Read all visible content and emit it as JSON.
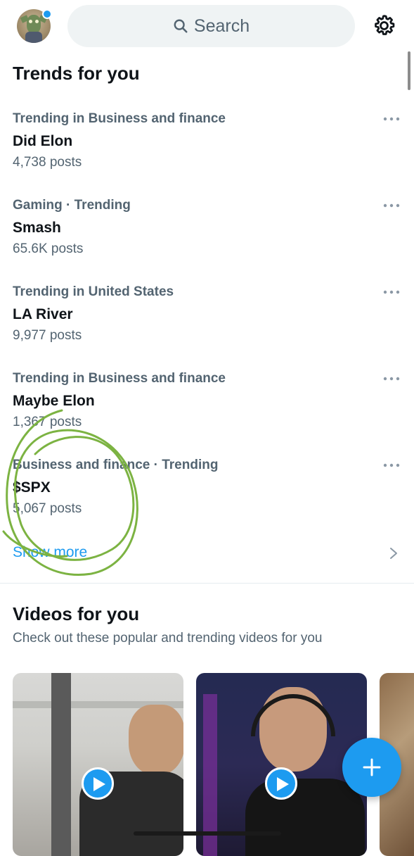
{
  "header": {
    "search_placeholder": "Search",
    "icons": {
      "search": "search-icon",
      "settings": "gear-icon"
    },
    "notification_dot_color": "#1d9bf0"
  },
  "trends_section": {
    "title": "Trends for you",
    "items": [
      {
        "context": "Trending in Business and finance",
        "name": "Did Elon",
        "posts": "4,738 posts"
      },
      {
        "context": "Gaming · Trending",
        "name": "Smash",
        "posts": "65.6K posts"
      },
      {
        "context": "Trending in United States",
        "name": "LA River",
        "posts": "9,977 posts"
      },
      {
        "context": "Trending in Business and finance",
        "name": "Maybe Elon",
        "posts": "1,367 posts"
      },
      {
        "context": "Business and finance · Trending",
        "name": "$SPX",
        "posts": "5,067 posts"
      }
    ],
    "show_more": "Show more"
  },
  "videos_section": {
    "title": "Videos for you",
    "subtitle": "Check out these popular and trending videos for you"
  },
  "colors": {
    "accent": "#1d9bf0",
    "text_primary": "#0f1419",
    "text_secondary": "#536471",
    "annotation": "#7cb342"
  }
}
